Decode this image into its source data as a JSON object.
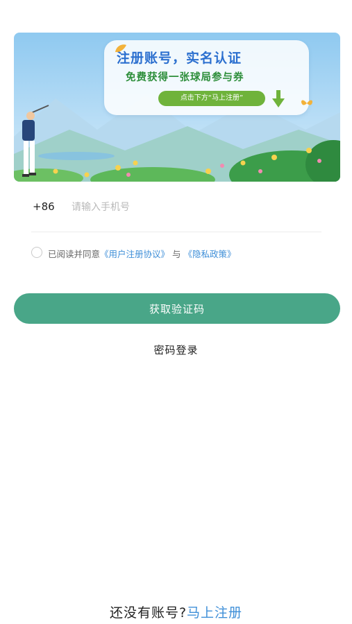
{
  "banner": {
    "title": "注册账号，实名认证",
    "subtitle": "免费获得一张球局参与券",
    "cta": "点击下方“马上注册”"
  },
  "form": {
    "country_code": "+86",
    "phone_placeholder": "请输入手机号",
    "phone_value": ""
  },
  "agreement": {
    "prefix": "已阅读并同意",
    "user_agreement": "《用户注册协议》",
    "joiner": "与",
    "privacy_policy": "《隐私政策》"
  },
  "actions": {
    "get_code": "获取验证码",
    "password_login": "密码登录"
  },
  "footer": {
    "prompt": "还没有账号?",
    "register_link": "马上注册"
  },
  "colors": {
    "primary": "#49a688",
    "link": "#3f8fd8",
    "banner_title": "#2b6fcf",
    "banner_subtitle": "#2d8e3a"
  }
}
